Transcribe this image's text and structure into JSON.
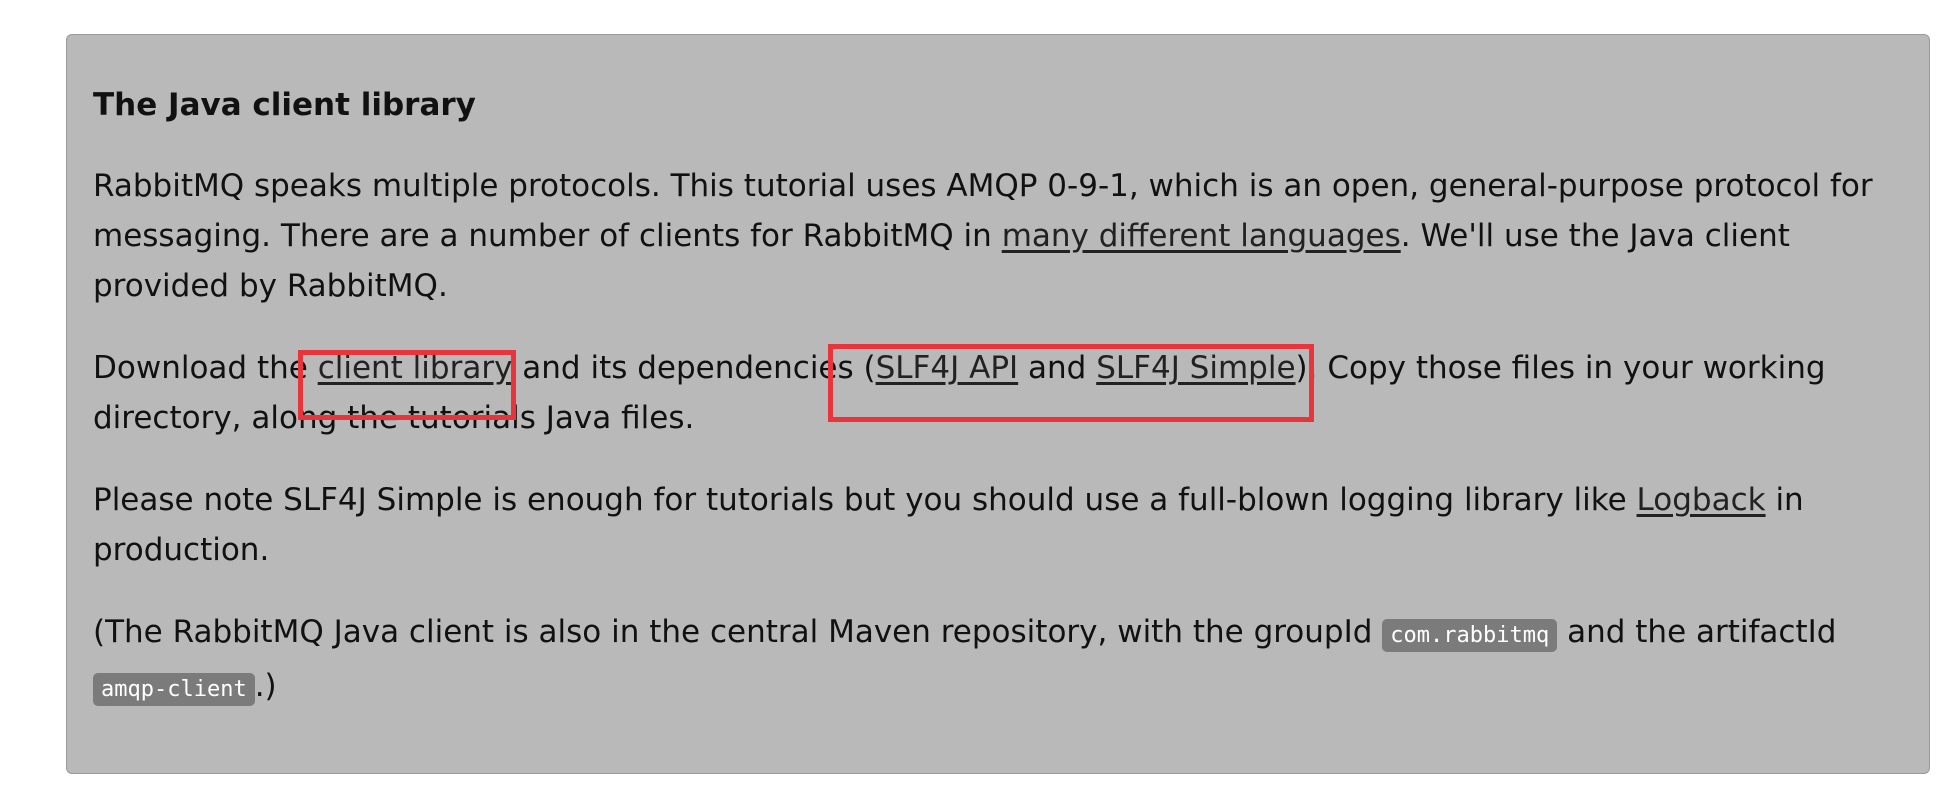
{
  "section": {
    "title": "The Java client library"
  },
  "para1": {
    "t1": "RabbitMQ speaks multiple protocols. This tutorial uses AMQP 0-9-1, which is an open, general-purpose protocol for messaging. There are a number of clients for RabbitMQ in ",
    "link": "many different languages",
    "t2": ". We'll use the Java client provided by RabbitMQ."
  },
  "para2": {
    "t1": "Download the ",
    "link_client": "client library",
    "t2": " and its dependencies (",
    "link_api": "SLF4J API",
    "t3": " and ",
    "link_simple": "SLF4J Simple",
    "t4": "). Copy those files in your working directory, along the tutorials Java files."
  },
  "para3": {
    "t1": "Please note SLF4J Simple is enough for tutorials but you should use a full-blown logging library like ",
    "link": "Logback",
    "t2": " in production."
  },
  "para4": {
    "t1": "(The RabbitMQ Java client is also in the central Maven repository, with the groupId ",
    "code1": "com.rabbitmq",
    "t2": " and the artifactId ",
    "code2": "amqp-client",
    "t3": ".)"
  },
  "colors": {
    "panel_bg": "#b9b9b9",
    "highlight": "#e8353b",
    "code_bg": "#7b7b7b"
  }
}
